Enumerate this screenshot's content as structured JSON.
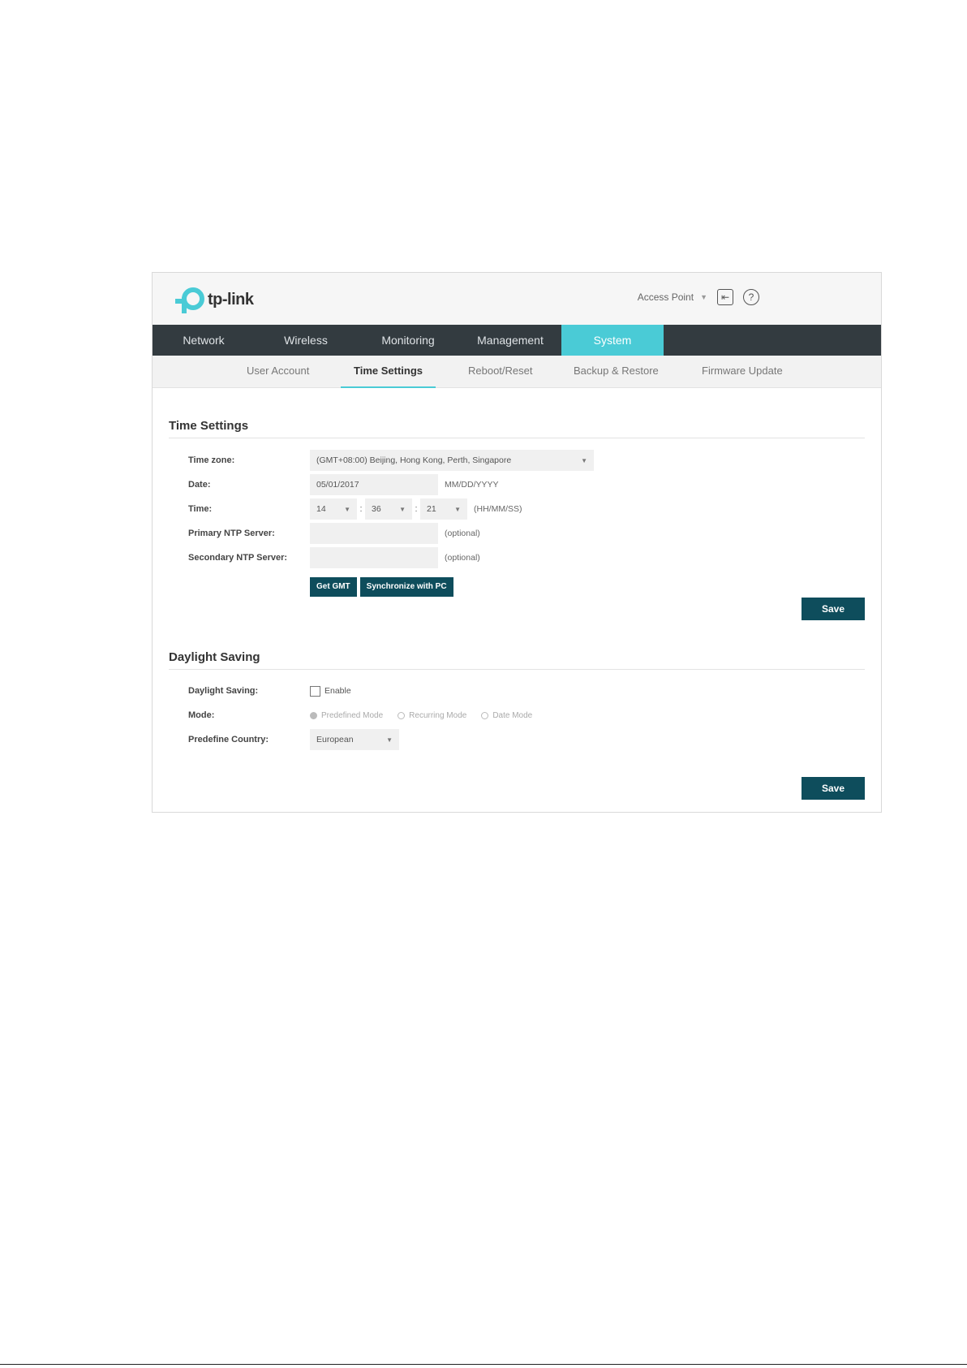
{
  "brand": {
    "name": "tp-link",
    "color": "#4acbd6"
  },
  "header": {
    "mode_label": "Access Point",
    "logout_icon": "logout-icon",
    "help_icon": "help-icon"
  },
  "main_nav": {
    "items": [
      "Network",
      "Wireless",
      "Monitoring",
      "Management",
      "System"
    ],
    "active": "System"
  },
  "sub_nav": {
    "items": [
      "User Account",
      "Time Settings",
      "Reboot/Reset",
      "Backup & Restore",
      "Firmware Update"
    ],
    "active": "Time Settings"
  },
  "time_settings": {
    "title": "Time Settings",
    "time_zone_label": "Time zone:",
    "time_zone_value": "(GMT+08:00) Beijing, Hong Kong, Perth, Singapore",
    "date_label": "Date:",
    "date_value": "05/01/2017",
    "date_hint": "MM/DD/YYYY",
    "time_label": "Time:",
    "time_hour": "14",
    "time_minute": "36",
    "time_second": "21",
    "time_separator": ":",
    "time_hint": "(HH/MM/SS)",
    "primary_ntp_label": "Primary NTP Server:",
    "primary_ntp_value": "",
    "primary_ntp_hint": "(optional)",
    "secondary_ntp_label": "Secondary NTP Server:",
    "secondary_ntp_value": "",
    "secondary_ntp_hint": "(optional)",
    "get_gmt_label": "Get GMT",
    "sync_pc_label": "Synchronize with PC",
    "save_label": "Save"
  },
  "daylight_saving": {
    "title": "Daylight Saving",
    "enable_label": "Daylight Saving:",
    "enable_text": "Enable",
    "enable_checked": false,
    "mode_label": "Mode:",
    "modes": [
      "Predefined Mode",
      "Recurring Mode",
      "Date Mode"
    ],
    "selected_mode": "Predefined Mode",
    "country_label": "Predefine Country:",
    "country_value": "European",
    "save_label": "Save"
  },
  "accent_colors": {
    "nav_bg": "#333b40",
    "active_tab": "#4acbd6",
    "button": "#0e4d5c"
  }
}
